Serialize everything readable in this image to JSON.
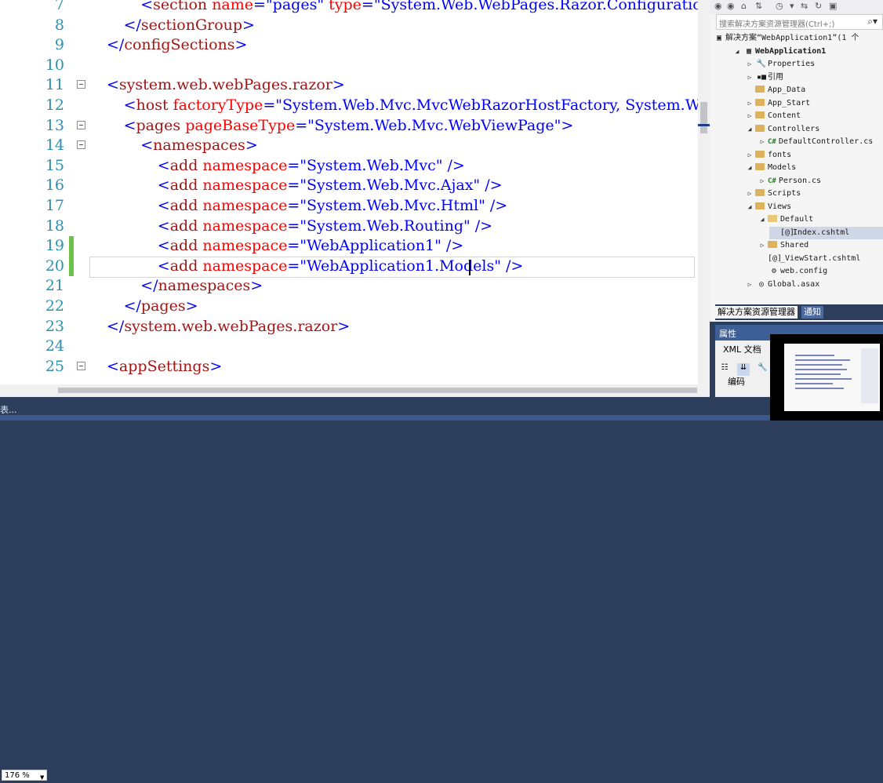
{
  "editor": {
    "lines": [
      {
        "num": "7",
        "fold": false,
        "mod": false,
        "indent": 2,
        "tokens": [
          [
            "d",
            "<"
          ],
          [
            "t",
            "section"
          ],
          [
            "p",
            " "
          ],
          [
            "a",
            "name"
          ],
          [
            "d",
            "="
          ],
          [
            "v",
            "\"pages\""
          ],
          [
            "p",
            " "
          ],
          [
            "a",
            "type"
          ],
          [
            "d",
            "="
          ],
          [
            "v",
            "\"System.Web.WebPages.Razor.Configuration."
          ]
        ]
      },
      {
        "num": "8",
        "fold": false,
        "mod": false,
        "indent": 1,
        "tokens": [
          [
            "d",
            "</"
          ],
          [
            "t",
            "sectionGroup"
          ],
          [
            "d",
            ">"
          ]
        ]
      },
      {
        "num": "9",
        "fold": false,
        "mod": false,
        "indent": 0,
        "tokens": [
          [
            "d",
            "</"
          ],
          [
            "t",
            "configSections"
          ],
          [
            "d",
            ">"
          ]
        ]
      },
      {
        "num": "10",
        "fold": false,
        "mod": false,
        "indent": 0,
        "tokens": []
      },
      {
        "num": "11",
        "fold": true,
        "mod": false,
        "indent": 0,
        "tokens": [
          [
            "d",
            "<"
          ],
          [
            "t",
            "system.web.webPages.razor"
          ],
          [
            "d",
            ">"
          ]
        ]
      },
      {
        "num": "12",
        "fold": false,
        "mod": false,
        "indent": 1,
        "tokens": [
          [
            "d",
            "<"
          ],
          [
            "t",
            "host"
          ],
          [
            "p",
            " "
          ],
          [
            "a",
            "factoryType"
          ],
          [
            "d",
            "="
          ],
          [
            "v",
            "\"System.Web.Mvc.MvcWebRazorHostFactory, System.Web.M"
          ]
        ]
      },
      {
        "num": "13",
        "fold": true,
        "mod": false,
        "indent": 1,
        "tokens": [
          [
            "d",
            "<"
          ],
          [
            "t",
            "pages"
          ],
          [
            "p",
            " "
          ],
          [
            "a",
            "pageBaseType"
          ],
          [
            "d",
            "="
          ],
          [
            "v",
            "\"System.Web.Mvc.WebViewPage\""
          ],
          [
            "d",
            ">"
          ]
        ]
      },
      {
        "num": "14",
        "fold": true,
        "mod": false,
        "indent": 2,
        "tokens": [
          [
            "d",
            "<"
          ],
          [
            "t",
            "namespaces"
          ],
          [
            "d",
            ">"
          ]
        ]
      },
      {
        "num": "15",
        "fold": false,
        "mod": false,
        "indent": 3,
        "tokens": [
          [
            "d",
            "<"
          ],
          [
            "t",
            "add"
          ],
          [
            "p",
            " "
          ],
          [
            "a",
            "namespace"
          ],
          [
            "d",
            "="
          ],
          [
            "v",
            "\"System.Web.Mvc\""
          ],
          [
            "p",
            " "
          ],
          [
            "d",
            "/>"
          ]
        ]
      },
      {
        "num": "16",
        "fold": false,
        "mod": false,
        "indent": 3,
        "tokens": [
          [
            "d",
            "<"
          ],
          [
            "t",
            "add"
          ],
          [
            "p",
            " "
          ],
          [
            "a",
            "namespace"
          ],
          [
            "d",
            "="
          ],
          [
            "v",
            "\"System.Web.Mvc.Ajax\""
          ],
          [
            "p",
            " "
          ],
          [
            "d",
            "/>"
          ]
        ]
      },
      {
        "num": "17",
        "fold": false,
        "mod": false,
        "indent": 3,
        "tokens": [
          [
            "d",
            "<"
          ],
          [
            "t",
            "add"
          ],
          [
            "p",
            " "
          ],
          [
            "a",
            "namespace"
          ],
          [
            "d",
            "="
          ],
          [
            "v",
            "\"System.Web.Mvc.Html\""
          ],
          [
            "p",
            " "
          ],
          [
            "d",
            "/>"
          ]
        ]
      },
      {
        "num": "18",
        "fold": false,
        "mod": false,
        "indent": 3,
        "tokens": [
          [
            "d",
            "<"
          ],
          [
            "t",
            "add"
          ],
          [
            "p",
            " "
          ],
          [
            "a",
            "namespace"
          ],
          [
            "d",
            "="
          ],
          [
            "v",
            "\"System.Web.Routing\""
          ],
          [
            "p",
            " "
          ],
          [
            "d",
            "/>"
          ]
        ]
      },
      {
        "num": "19",
        "fold": false,
        "mod": true,
        "indent": 3,
        "tokens": [
          [
            "d",
            "<"
          ],
          [
            "t",
            "add"
          ],
          [
            "p",
            " "
          ],
          [
            "a",
            "namespace"
          ],
          [
            "d",
            "="
          ],
          [
            "v",
            "\"WebApplication1\""
          ],
          [
            "p",
            " "
          ],
          [
            "d",
            "/>"
          ]
        ]
      },
      {
        "num": "20",
        "fold": false,
        "mod": true,
        "indent": 3,
        "tokens": [
          [
            "d",
            "<"
          ],
          [
            "t",
            "add"
          ],
          [
            "p",
            " "
          ],
          [
            "a",
            "namespace"
          ],
          [
            "d",
            "="
          ],
          [
            "v",
            "\"WebApplication1.Models"
          ],
          [
            "v",
            "\""
          ],
          [
            "p",
            " "
          ],
          [
            "d",
            "/>"
          ]
        ]
      },
      {
        "num": "21",
        "fold": false,
        "mod": false,
        "indent": 2,
        "tokens": [
          [
            "d",
            "</"
          ],
          [
            "t",
            "namespaces"
          ],
          [
            "d",
            ">"
          ]
        ]
      },
      {
        "num": "22",
        "fold": false,
        "mod": false,
        "indent": 1,
        "tokens": [
          [
            "d",
            "</"
          ],
          [
            "t",
            "pages"
          ],
          [
            "d",
            ">"
          ]
        ]
      },
      {
        "num": "23",
        "fold": false,
        "mod": false,
        "indent": 0,
        "tokens": [
          [
            "d",
            "</"
          ],
          [
            "t",
            "system.web.webPages.razor"
          ],
          [
            "d",
            ">"
          ]
        ]
      },
      {
        "num": "24",
        "fold": false,
        "mod": false,
        "indent": 0,
        "tokens": []
      },
      {
        "num": "25",
        "fold": true,
        "mod": false,
        "indent": 0,
        "tokens": [
          [
            "d",
            "<"
          ],
          [
            "t",
            "appSettings"
          ],
          [
            "d",
            ">"
          ]
        ]
      }
    ],
    "zoom": "176 %"
  },
  "status": {
    "text": "表..."
  },
  "solution_explorer": {
    "search_placeholder": "搜索解决方案资源管理器(Ctrl+;)",
    "items": [
      {
        "label": "解决方案“WebApplication1”(1 个",
        "level": 0,
        "expander": "",
        "icon": "solution-icon",
        "glyph": "▣",
        "bold": false,
        "selected": false
      },
      {
        "label": "WebApplication1",
        "level": 1,
        "expander": "◢",
        "icon": "project-icon",
        "glyph": "▦",
        "bold": true,
        "selected": false
      },
      {
        "label": "Properties",
        "level": 2,
        "expander": "▷",
        "icon": "wrench-icon",
        "glyph": "🔧",
        "bold": false,
        "selected": false
      },
      {
        "label": "引用",
        "level": 2,
        "expander": "▷",
        "icon": "references-icon",
        "glyph": "▪■",
        "bold": false,
        "selected": false
      },
      {
        "label": "App_Data",
        "level": 2,
        "expander": "",
        "icon": "folder-icon",
        "glyph": "",
        "bold": false,
        "selected": false
      },
      {
        "label": "App_Start",
        "level": 2,
        "expander": "▷",
        "icon": "folder-icon",
        "glyph": "",
        "bold": false,
        "selected": false
      },
      {
        "label": "Content",
        "level": 2,
        "expander": "▷",
        "icon": "folder-icon",
        "glyph": "",
        "bold": false,
        "selected": false
      },
      {
        "label": "Controllers",
        "level": 2,
        "expander": "◢",
        "icon": "folder-icon",
        "glyph": "",
        "bold": false,
        "selected": false
      },
      {
        "label": "DefaultController.cs",
        "level": 3,
        "expander": "▷",
        "icon": "csharp-file-icon",
        "glyph": "C#",
        "bold": false,
        "selected": false
      },
      {
        "label": "fonts",
        "level": 2,
        "expander": "▷",
        "icon": "folder-icon",
        "glyph": "",
        "bold": false,
        "selected": false
      },
      {
        "label": "Models",
        "level": 2,
        "expander": "◢",
        "icon": "folder-icon",
        "glyph": "",
        "bold": false,
        "selected": false
      },
      {
        "label": "Person.cs",
        "level": 3,
        "expander": "▷",
        "icon": "csharp-file-icon",
        "glyph": "C#",
        "bold": false,
        "selected": false
      },
      {
        "label": "Scripts",
        "level": 2,
        "expander": "▷",
        "icon": "folder-icon",
        "glyph": "",
        "bold": false,
        "selected": false
      },
      {
        "label": "Views",
        "level": 2,
        "expander": "◢",
        "icon": "folder-icon",
        "glyph": "",
        "bold": false,
        "selected": false
      },
      {
        "label": "Default",
        "level": 3,
        "expander": "◢",
        "icon": "folder-open-icon",
        "glyph": "",
        "bold": false,
        "selected": false
      },
      {
        "label": "Index.cshtml",
        "level": 4,
        "expander": "",
        "icon": "razor-file-icon",
        "glyph": "[@]",
        "bold": false,
        "selected": true
      },
      {
        "label": "Shared",
        "level": 3,
        "expander": "▷",
        "icon": "folder-icon",
        "glyph": "",
        "bold": false,
        "selected": false
      },
      {
        "label": "_ViewStart.cshtml",
        "level": 3,
        "expander": "",
        "icon": "razor-file-icon",
        "glyph": "[@]",
        "bold": false,
        "selected": false
      },
      {
        "label": "web.config",
        "level": 3,
        "expander": "",
        "icon": "config-file-icon",
        "glyph": "⚙",
        "bold": false,
        "selected": false
      },
      {
        "label": "Global.asax",
        "level": 2,
        "expander": "▷",
        "icon": "global-file-icon",
        "glyph": "◎",
        "bold": false,
        "selected": false
      }
    ],
    "tabs": [
      "解决方案资源管理器",
      "通知"
    ]
  },
  "properties": {
    "title": "属性",
    "object": "XML 文档",
    "row_label": "编码"
  },
  "colors": {
    "tag": "#a31515",
    "attribute": "#ff0000",
    "value": "#0000ff",
    "line_number": "#2b91af",
    "change_marker": "#6cc24a",
    "chrome": "#2d3e5c"
  }
}
